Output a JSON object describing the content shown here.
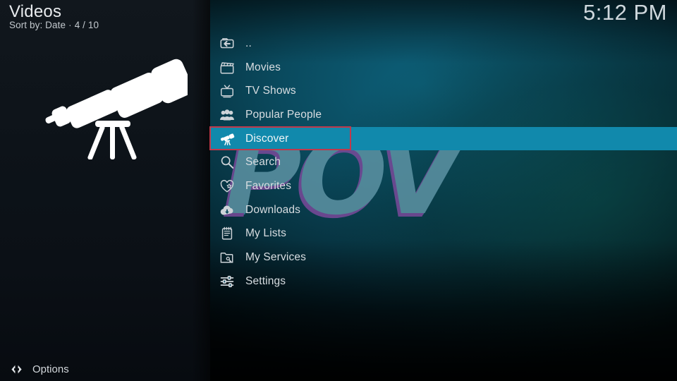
{
  "header": {
    "title": "Videos",
    "sort_label": "Sort by: Date",
    "separator": "·",
    "position": "4 / 10",
    "clock": "5:12 PM"
  },
  "artwork": {
    "name": "telescope-illustration",
    "color": "#ffffff"
  },
  "watermark": {
    "text": "POV",
    "fill": "#5d93a4",
    "shadow_purple": "#7a4a9a",
    "shadow_cyan": "#2f93a8"
  },
  "menu": {
    "selected_index": 4,
    "highlight_color": "#1189ac",
    "annotation_color": "#c0394b",
    "items": [
      {
        "label": "..",
        "icon": "back-arrow-icon"
      },
      {
        "label": "Movies",
        "icon": "clapperboard-icon"
      },
      {
        "label": "TV Shows",
        "icon": "television-icon"
      },
      {
        "label": "Popular People",
        "icon": "people-group-icon"
      },
      {
        "label": "Discover",
        "icon": "telescope-icon"
      },
      {
        "label": "Search",
        "icon": "magnifier-icon"
      },
      {
        "label": "Favorites",
        "icon": "heart-star-icon"
      },
      {
        "label": "Downloads",
        "icon": "cloud-download-icon"
      },
      {
        "label": "My Lists",
        "icon": "notepad-icon"
      },
      {
        "label": "My Services",
        "icon": "folder-gear-icon"
      },
      {
        "label": "Settings",
        "icon": "sliders-icon"
      }
    ]
  },
  "footer": {
    "options_label": "Options",
    "icon": "left-right-arrows-icon"
  },
  "theme": {
    "panel_background": "#0d1319",
    "accent": "#1189ac",
    "text_primary": "#d8dde1"
  }
}
